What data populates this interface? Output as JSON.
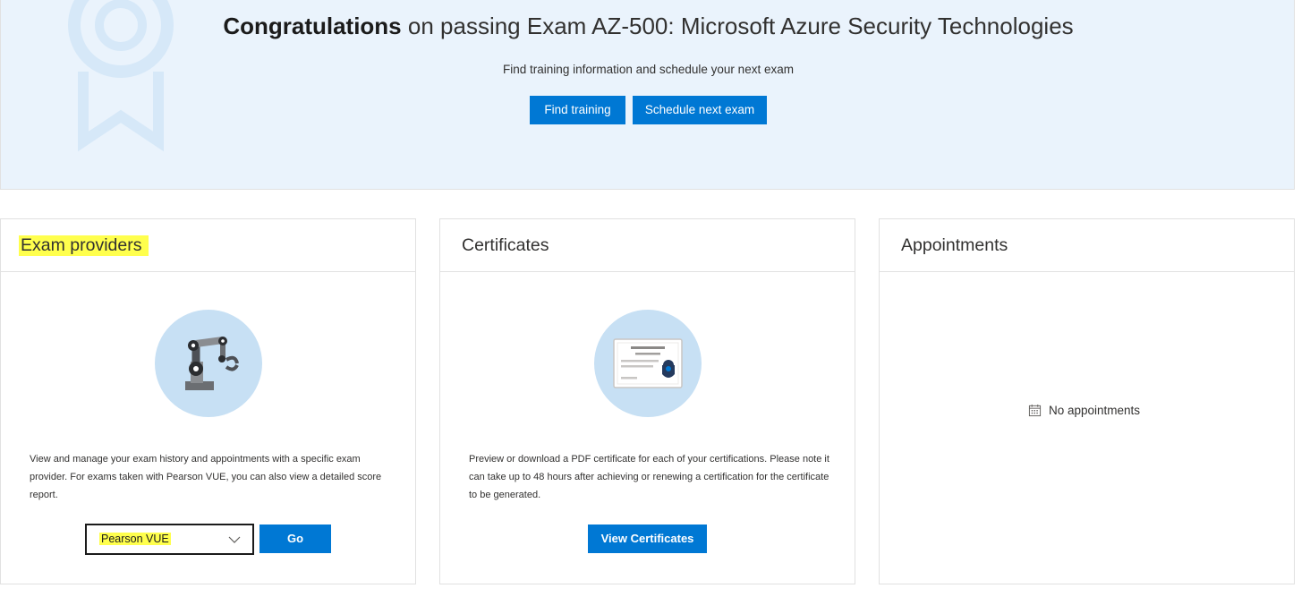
{
  "hero": {
    "title_strong": "Congratulations",
    "title_rest": " on passing Exam AZ-500: Microsoft Azure Security Technologies",
    "subtitle": "Find training information and schedule your next exam",
    "find_training_label": "Find training",
    "schedule_label": "Schedule next exam",
    "icon": "award-ribbon-icon"
  },
  "cards": {
    "providers": {
      "title": "Exam providers",
      "icon": "robot-arm-icon",
      "description": "View and manage your exam history and appointments with a specific exam provider. For exams taken with Pearson VUE, you can also view a detailed score report.",
      "select_value": "Pearson VUE",
      "go_label": "Go"
    },
    "certificates": {
      "title": "Certificates",
      "icon": "certificate-icon",
      "description": "Preview or download a PDF certificate for each of your certifications. Please note it can take up to 48 hours after achieving or renewing a certification for the certificate to be generated.",
      "button_label": "View Certificates"
    },
    "appointments": {
      "title": "Appointments",
      "empty_text": "No appointments",
      "icon": "calendar-icon"
    }
  },
  "colors": {
    "accent": "#0078d4",
    "hero_bg": "#eaf3fc",
    "highlight": "#ffff4d",
    "illustration_bg": "#c7e0f4"
  }
}
